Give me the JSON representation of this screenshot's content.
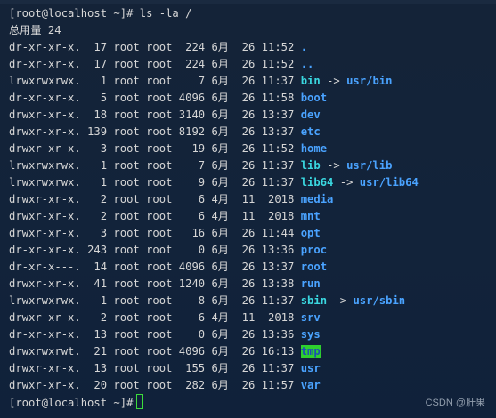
{
  "prompt_top": "[root@localhost ~]# ls -la /",
  "total_line": "总用量 24",
  "entries": [
    {
      "perm": "dr-xr-xr-x.",
      "links": "17",
      "owner": "root",
      "group": "root",
      "size": "224",
      "month": "6月",
      "day": "26",
      "time": "11:52",
      "name": ".",
      "target": ""
    },
    {
      "perm": "dr-xr-xr-x.",
      "links": "17",
      "owner": "root",
      "group": "root",
      "size": "224",
      "month": "6月",
      "day": "26",
      "time": "11:52",
      "name": "..",
      "target": ""
    },
    {
      "perm": "lrwxrwxrwx.",
      "links": "1",
      "owner": "root",
      "group": "root",
      "size": "7",
      "month": "6月",
      "day": "26",
      "time": "11:37",
      "name": "bin",
      "target": "usr/bin"
    },
    {
      "perm": "dr-xr-xr-x.",
      "links": "5",
      "owner": "root",
      "group": "root",
      "size": "4096",
      "month": "6月",
      "day": "26",
      "time": "11:58",
      "name": "boot",
      "target": ""
    },
    {
      "perm": "drwxr-xr-x.",
      "links": "18",
      "owner": "root",
      "group": "root",
      "size": "3140",
      "month": "6月",
      "day": "26",
      "time": "13:37",
      "name": "dev",
      "target": ""
    },
    {
      "perm": "drwxr-xr-x.",
      "links": "139",
      "owner": "root",
      "group": "root",
      "size": "8192",
      "month": "6月",
      "day": "26",
      "time": "13:37",
      "name": "etc",
      "target": ""
    },
    {
      "perm": "drwxr-xr-x.",
      "links": "3",
      "owner": "root",
      "group": "root",
      "size": "19",
      "month": "6月",
      "day": "26",
      "time": "11:52",
      "name": "home",
      "target": ""
    },
    {
      "perm": "lrwxrwxrwx.",
      "links": "1",
      "owner": "root",
      "group": "root",
      "size": "7",
      "month": "6月",
      "day": "26",
      "time": "11:37",
      "name": "lib",
      "target": "usr/lib"
    },
    {
      "perm": "lrwxrwxrwx.",
      "links": "1",
      "owner": "root",
      "group": "root",
      "size": "9",
      "month": "6月",
      "day": "26",
      "time": "11:37",
      "name": "lib64",
      "target": "usr/lib64"
    },
    {
      "perm": "drwxr-xr-x.",
      "links": "2",
      "owner": "root",
      "group": "root",
      "size": "6",
      "month": "4月",
      "day": "11",
      "time": "2018",
      "name": "media",
      "target": ""
    },
    {
      "perm": "drwxr-xr-x.",
      "links": "2",
      "owner": "root",
      "group": "root",
      "size": "6",
      "month": "4月",
      "day": "11",
      "time": "2018",
      "name": "mnt",
      "target": ""
    },
    {
      "perm": "drwxr-xr-x.",
      "links": "3",
      "owner": "root",
      "group": "root",
      "size": "16",
      "month": "6月",
      "day": "26",
      "time": "11:44",
      "name": "opt",
      "target": ""
    },
    {
      "perm": "dr-xr-xr-x.",
      "links": "243",
      "owner": "root",
      "group": "root",
      "size": "0",
      "month": "6月",
      "day": "26",
      "time": "13:36",
      "name": "proc",
      "target": ""
    },
    {
      "perm": "dr-xr-x---.",
      "links": "14",
      "owner": "root",
      "group": "root",
      "size": "4096",
      "month": "6月",
      "day": "26",
      "time": "13:37",
      "name": "root",
      "target": ""
    },
    {
      "perm": "drwxr-xr-x.",
      "links": "41",
      "owner": "root",
      "group": "root",
      "size": "1240",
      "month": "6月",
      "day": "26",
      "time": "13:38",
      "name": "run",
      "target": ""
    },
    {
      "perm": "lrwxrwxrwx.",
      "links": "1",
      "owner": "root",
      "group": "root",
      "size": "8",
      "month": "6月",
      "day": "26",
      "time": "11:37",
      "name": "sbin",
      "target": "usr/sbin"
    },
    {
      "perm": "drwxr-xr-x.",
      "links": "2",
      "owner": "root",
      "group": "root",
      "size": "6",
      "month": "4月",
      "day": "11",
      "time": "2018",
      "name": "srv",
      "target": ""
    },
    {
      "perm": "dr-xr-xr-x.",
      "links": "13",
      "owner": "root",
      "group": "root",
      "size": "0",
      "month": "6月",
      "day": "26",
      "time": "13:36",
      "name": "sys",
      "target": ""
    },
    {
      "perm": "drwxrwxrwt.",
      "links": "21",
      "owner": "root",
      "group": "root",
      "size": "4096",
      "month": "6月",
      "day": "26",
      "time": "16:13",
      "name": "tmp",
      "target": ""
    },
    {
      "perm": "drwxr-xr-x.",
      "links": "13",
      "owner": "root",
      "group": "root",
      "size": "155",
      "month": "6月",
      "day": "26",
      "time": "11:37",
      "name": "usr",
      "target": ""
    },
    {
      "perm": "drwxr-xr-x.",
      "links": "20",
      "owner": "root",
      "group": "root",
      "size": "282",
      "month": "6月",
      "day": "26",
      "time": "11:57",
      "name": "var",
      "target": ""
    }
  ],
  "arrow": "->",
  "prompt_bottom": "[root@localhost ~]#",
  "watermark": "CSDN @肝果",
  "colors": {
    "background": "#12233a",
    "text": "#d6d6d6",
    "directory": "#4aa3ff",
    "symlink": "#3ad7e0",
    "sticky_bg": "#2ed02e",
    "cursor": "#3cdc3c"
  }
}
